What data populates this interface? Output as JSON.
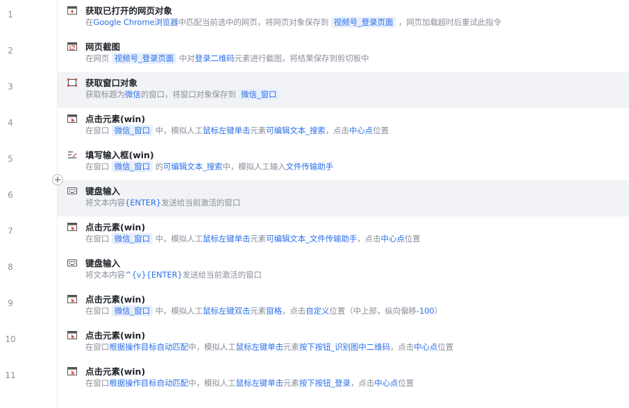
{
  "steps": [
    {
      "num": "1",
      "icon": "browser-icon",
      "title": "获取已打开的网页对象",
      "desc": [
        [
          "t",
          "在"
        ],
        [
          "h",
          "Google Chrome浏览器"
        ],
        [
          "t",
          "中匹配当前选中的网页，将网页对象保存到 "
        ],
        [
          "g",
          "视频号_登录页面"
        ],
        [
          "t",
          " ，网页加载超时后重试此指令"
        ]
      ]
    },
    {
      "num": "2",
      "icon": "screenshot-icon",
      "title": "网页截图",
      "desc": [
        [
          "t",
          "在网页 "
        ],
        [
          "g",
          "视频号_登录页面"
        ],
        [
          "t",
          " 中对"
        ],
        [
          "h",
          "登录二维码"
        ],
        [
          "t",
          "元素进行截图，将结果保存到剪切板中"
        ]
      ]
    },
    {
      "num": "3",
      "icon": "window-icon",
      "title": "获取窗口对象",
      "selected": true,
      "desc": [
        [
          "t",
          "获取标题为"
        ],
        [
          "h",
          "微信"
        ],
        [
          "t",
          "的窗口，将窗口对象保存到 "
        ],
        [
          "g",
          "微信_窗口"
        ]
      ]
    },
    {
      "num": "4",
      "icon": "click-element-icon",
      "title": "点击元素(win)",
      "desc": [
        [
          "t",
          "在窗口 "
        ],
        [
          "g",
          "微信_窗口"
        ],
        [
          "t",
          " 中，模拟人工"
        ],
        [
          "h",
          "鼠标左键单击"
        ],
        [
          "t",
          "元素"
        ],
        [
          "h",
          "可编辑文本_搜索"
        ],
        [
          "t",
          "，点击"
        ],
        [
          "h",
          "中心点"
        ],
        [
          "t",
          "位置"
        ]
      ]
    },
    {
      "num": "5",
      "icon": "input-box-icon",
      "title": "填写输入框(win)",
      "desc": [
        [
          "t",
          "在窗口 "
        ],
        [
          "g",
          "微信_窗口"
        ],
        [
          "t",
          " 的"
        ],
        [
          "h",
          "可编辑文本_搜索"
        ],
        [
          "t",
          "中，模拟人工输入"
        ],
        [
          "h",
          "文件传输助手"
        ]
      ]
    },
    {
      "num": "6",
      "icon": "keyboard-icon",
      "title": "键盘输入",
      "selected": true,
      "desc": [
        [
          "t",
          "将文本内容"
        ],
        [
          "h",
          "{ENTER}"
        ],
        [
          "t",
          "发送给当前激活的窗口"
        ]
      ]
    },
    {
      "num": "7",
      "icon": "click-element-icon",
      "title": "点击元素(win)",
      "desc": [
        [
          "t",
          "在窗口 "
        ],
        [
          "g",
          "微信_窗口"
        ],
        [
          "t",
          " 中，模拟人工"
        ],
        [
          "h",
          "鼠标左键单击"
        ],
        [
          "t",
          "元素"
        ],
        [
          "h",
          "可编辑文本_文件传输助手"
        ],
        [
          "t",
          "，点击"
        ],
        [
          "h",
          "中心点"
        ],
        [
          "t",
          "位置"
        ]
      ]
    },
    {
      "num": "8",
      "icon": "keyboard-icon",
      "title": "键盘输入",
      "desc": [
        [
          "t",
          "将文本内容"
        ],
        [
          "h",
          "^{v}{ENTER}"
        ],
        [
          "t",
          "发送给当前激活的窗口"
        ]
      ]
    },
    {
      "num": "9",
      "icon": "click-element-icon",
      "title": "点击元素(win)",
      "desc": [
        [
          "t",
          "在窗口 "
        ],
        [
          "g",
          "微信_窗口"
        ],
        [
          "t",
          " 中，模拟人工"
        ],
        [
          "h",
          "鼠标左键双击"
        ],
        [
          "t",
          "元素"
        ],
        [
          "h",
          "窗格"
        ],
        [
          "t",
          "，点击"
        ],
        [
          "h",
          "自定义"
        ],
        [
          "t",
          "位置（中上部，纵向偏移"
        ],
        [
          "h",
          "-100"
        ],
        [
          "t",
          "）"
        ]
      ]
    },
    {
      "num": "10",
      "icon": "click-element-icon",
      "title": "点击元素(win)",
      "desc": [
        [
          "t",
          "在窗口"
        ],
        [
          "h",
          "根据操作目标自动匹配"
        ],
        [
          "t",
          "中，模拟人工"
        ],
        [
          "h",
          "鼠标左键单击"
        ],
        [
          "t",
          "元素"
        ],
        [
          "h",
          "按下按钮_识别图中二维码"
        ],
        [
          "t",
          "，点击"
        ],
        [
          "h",
          "中心点"
        ],
        [
          "t",
          "位置"
        ]
      ]
    },
    {
      "num": "11",
      "icon": "click-element-icon",
      "title": "点击元素(win)",
      "desc": [
        [
          "t",
          "在窗口"
        ],
        [
          "h",
          "根据操作目标自动匹配"
        ],
        [
          "t",
          "中，模拟人工"
        ],
        [
          "h",
          "鼠标左键单击"
        ],
        [
          "t",
          "元素"
        ],
        [
          "h",
          "按下按钮_登录"
        ],
        [
          "t",
          "，点击"
        ],
        [
          "h",
          "中心点"
        ],
        [
          "t",
          "位置"
        ]
      ]
    }
  ],
  "insert_button_label": "+",
  "colors": {
    "accent": "#2b6fe8",
    "tag_bg": "#e8f0fd",
    "icon_red": "#e0524c",
    "selected_row": "#f2f3f6"
  }
}
